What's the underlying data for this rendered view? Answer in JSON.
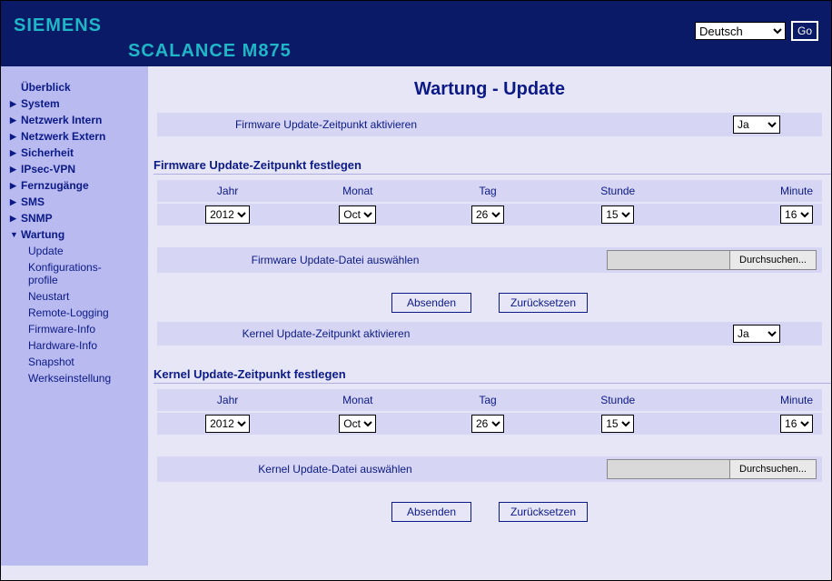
{
  "header": {
    "logo": "SIEMENS",
    "product": "SCALANCE M875",
    "language_selected": "Deutsch",
    "go_label": "Go"
  },
  "sidebar": {
    "items": [
      {
        "label": "Überblick",
        "arrow": false
      },
      {
        "label": "System",
        "arrow": true
      },
      {
        "label": "Netzwerk Intern",
        "arrow": true
      },
      {
        "label": "Netzwerk Extern",
        "arrow": true
      },
      {
        "label": "Sicherheit",
        "arrow": true
      },
      {
        "label": "IPsec-VPN",
        "arrow": true
      },
      {
        "label": "Fernzugänge",
        "arrow": true
      },
      {
        "label": "SMS",
        "arrow": true
      },
      {
        "label": "SNMP",
        "arrow": true
      },
      {
        "label": "Wartung",
        "arrow": true
      }
    ],
    "sub": [
      "Update",
      "Konfigurations-\nprofile",
      "Neustart",
      "Remote-Logging",
      "Firmware-Info",
      "Hardware-Info",
      "Snapshot",
      "Werkseinstellung"
    ]
  },
  "page": {
    "title": "Wartung - Update",
    "firmware": {
      "activate_label": "Firmware Update-Zeitpunkt aktivieren",
      "activate_value": "Ja",
      "section_title": "Firmware Update-Zeitpunkt festlegen",
      "cols": {
        "year": "Jahr",
        "month": "Monat",
        "day": "Tag",
        "hour": "Stunde",
        "minute": "Minute"
      },
      "vals": {
        "year": "2012",
        "month": "Oct",
        "day": "26",
        "hour": "15",
        "minute": "16"
      },
      "file_label": "Firmware Update-Datei auswählen",
      "browse": "Durchsuchen...",
      "submit": "Absenden",
      "reset": "Zurücksetzen"
    },
    "kernel": {
      "activate_label": "Kernel Update-Zeitpunkt aktivieren",
      "activate_value": "Ja",
      "section_title": "Kernel Update-Zeitpunkt festlegen",
      "cols": {
        "year": "Jahr",
        "month": "Monat",
        "day": "Tag",
        "hour": "Stunde",
        "minute": "Minute"
      },
      "vals": {
        "year": "2012",
        "month": "Oct",
        "day": "26",
        "hour": "15",
        "minute": "16"
      },
      "file_label": "Kernel Update-Datei auswählen",
      "browse": "Durchsuchen...",
      "submit": "Absenden",
      "reset": "Zurücksetzen"
    }
  }
}
